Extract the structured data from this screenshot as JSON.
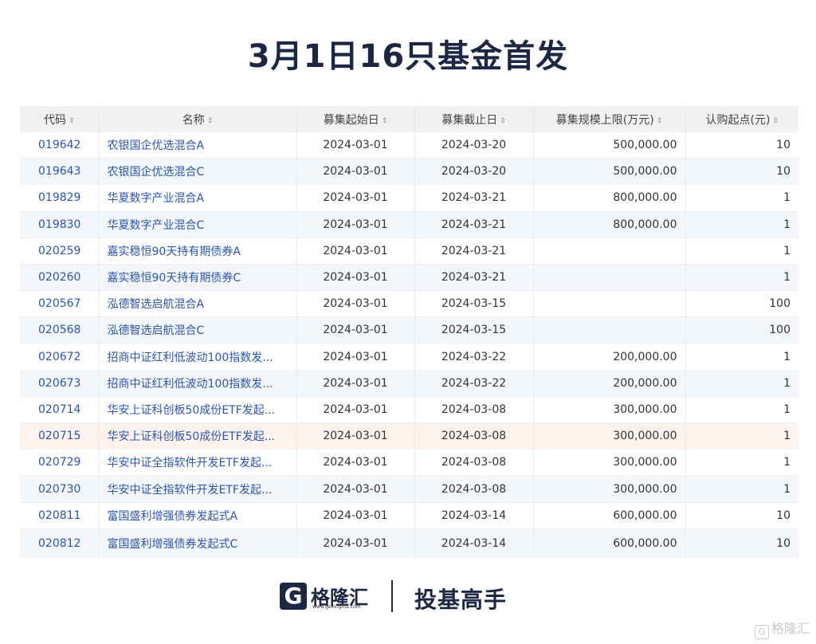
{
  "title": "3月1日16只基金首发",
  "table": {
    "headers": [
      "代码",
      "名称",
      "募集起始日",
      "募集截止日",
      "募集规模上限(万元)",
      "认购起点(元)"
    ],
    "sort_glyph": "⇕",
    "rows": [
      [
        "019642",
        "农银国企优选混合A",
        "2024-03-01",
        "2024-03-20",
        "500,000.00",
        "10"
      ],
      [
        "019643",
        "农银国企优选混合C",
        "2024-03-01",
        "2024-03-20",
        "500,000.00",
        "10"
      ],
      [
        "019829",
        "华夏数字产业混合A",
        "2024-03-01",
        "2024-03-21",
        "800,000.00",
        "1"
      ],
      [
        "019830",
        "华夏数字产业混合C",
        "2024-03-01",
        "2024-03-21",
        "800,000.00",
        "1"
      ],
      [
        "020259",
        "嘉实稳恒90天持有期债券A",
        "2024-03-01",
        "2024-03-21",
        "",
        "1"
      ],
      [
        "020260",
        "嘉实稳恒90天持有期债券C",
        "2024-03-01",
        "2024-03-21",
        "",
        "1"
      ],
      [
        "020567",
        "泓德智选启航混合A",
        "2024-03-01",
        "2024-03-15",
        "",
        "100"
      ],
      [
        "020568",
        "泓德智选启航混合C",
        "2024-03-01",
        "2024-03-15",
        "",
        "100"
      ],
      [
        "020672",
        "招商中证红利低波动100指数发...",
        "2024-03-01",
        "2024-03-22",
        "200,000.00",
        "1"
      ],
      [
        "020673",
        "招商中证红利低波动100指数发...",
        "2024-03-01",
        "2024-03-22",
        "200,000.00",
        "1"
      ],
      [
        "020714",
        "华安上证科创板50成份ETF发起...",
        "2024-03-01",
        "2024-03-08",
        "300,000.00",
        "1"
      ],
      [
        "020715",
        "华安上证科创板50成份ETF发起...",
        "2024-03-01",
        "2024-03-08",
        "300,000.00",
        "1"
      ],
      [
        "020729",
        "华安中证全指软件开发ETF发起...",
        "2024-03-01",
        "2024-03-08",
        "300,000.00",
        "1"
      ],
      [
        "020730",
        "华安中证全指软件开发ETF发起...",
        "2024-03-01",
        "2024-03-08",
        "300,000.00",
        "1"
      ],
      [
        "020811",
        "富国盛利增强债券发起式A",
        "2024-03-01",
        "2024-03-14",
        "600,000.00",
        "10"
      ],
      [
        "020812",
        "富国盛利增强债券发起式C",
        "2024-03-01",
        "2024-03-14",
        "600,000.00",
        "10"
      ]
    ],
    "highlighted_row": "020715"
  },
  "footer": {
    "logo_letter": "G",
    "logo_text": "格隆汇",
    "logo_url": "www.gelonghui.com",
    "slogan": "投基高手",
    "watermark_icon": "G",
    "watermark_text": "格隆汇"
  },
  "colors": {
    "title": "#1c2744",
    "link": "#2a56b0",
    "header_bg": "#f0f1f3",
    "stripe_bg": "#f3f6fb",
    "highlight_bg": "#fdf3ee"
  }
}
